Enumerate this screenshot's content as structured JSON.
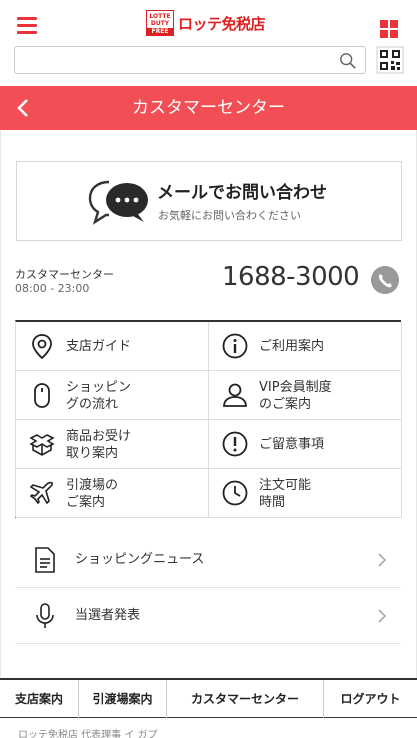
{
  "header": {
    "logo_lines": [
      "LOTTE",
      "DUTY",
      "FREE"
    ],
    "logo_text": "ロッテ免税店"
  },
  "search": {
    "value": "",
    "placeholder": ""
  },
  "titlebar": {
    "title": "カスタマーセンター"
  },
  "mail": {
    "title": "メールでお問い合わせ",
    "subtitle": "お気軽にお問い合わください"
  },
  "contact": {
    "label": "カスタマーセンター",
    "hours": "08:00 - 23:00",
    "phone": "1688-3000"
  },
  "menu_grid": [
    {
      "label": "支店ガイド",
      "icon": "location-pin-icon"
    },
    {
      "label": "ご利用案内",
      "icon": "info-icon"
    },
    {
      "label": "ショッピン\nグの流れ",
      "icon": "mouse-icon"
    },
    {
      "label": "VIP会員制度\nのご案内",
      "icon": "user-icon"
    },
    {
      "label": "商品お受け\n取り案内",
      "icon": "boxes-icon"
    },
    {
      "label": "ご留意事項",
      "icon": "exclamation-icon"
    },
    {
      "label": "引渡場の\nご案内",
      "icon": "airplane-icon"
    },
    {
      "label": "注文可能\n時間",
      "icon": "clock-icon"
    }
  ],
  "list": [
    {
      "label": "ショッピングニュース",
      "icon": "document-icon"
    },
    {
      "label": "当選者発表",
      "icon": "microphone-icon"
    }
  ],
  "bottom_nav": [
    "支店案内",
    "引渡場案内",
    "カスタマーセンター",
    "ログアウト"
  ],
  "footer_text": "ロッテ免税店 代表理事 イ ガプ",
  "colors": {
    "accent": "#f14f55",
    "brand_red": "#e02020"
  }
}
